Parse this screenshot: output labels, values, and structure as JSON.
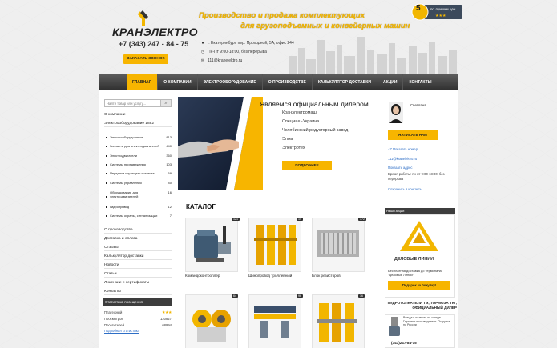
{
  "header": {
    "logo_text": "КРАНЭЛЕКТРО",
    "phone": "+7 (343) 247 - 84 - 75",
    "callback_label": "ЗАКАЗАТЬ ЗВОНОК",
    "tagline_1": "Производство и продажа комплектующих",
    "tagline_2": "для грузоподъемных и конвейерных машин",
    "address": "г. Екатеринбург, пер. Проходной, 5А, офис 244",
    "hours": "Пн-Пт 9:00-18:00, без перерыва",
    "email": "111@kranelektro.ru",
    "badge_number": "5",
    "badge_text": "по лучшим цен"
  },
  "nav": {
    "items": [
      {
        "label": "ГЛАВНАЯ"
      },
      {
        "label": "О КОМПАНИИ"
      },
      {
        "label": "ЭЛЕКТРООБОРУДОВАНИЕ"
      },
      {
        "label": "О ПРОИЗВОДСТВЕ"
      },
      {
        "label": "КАЛЬКУЛЯТОР ДОСТАВКИ"
      },
      {
        "label": "АКЦИИ"
      },
      {
        "label": "КОНТАКТЫ"
      }
    ]
  },
  "sidebar": {
    "search_placeholder": "Найти товар или услугу...",
    "search_icon": "search-icon",
    "link_company": "О компании",
    "link_equipment": "Электрооборудование 1882",
    "subitems": [
      {
        "label": "Электрооборудование",
        "count": "813"
      },
      {
        "label": "Запчасти для электродвигателей",
        "count": "440"
      },
      {
        "label": "Электродвигатели",
        "count": "360"
      },
      {
        "label": "Системы передвижения",
        "count": "103"
      },
      {
        "label": "Передача крутящего момента",
        "count": "69"
      },
      {
        "label": "Системы управления",
        "count": "40"
      },
      {
        "label": "Оборудование для электродвигателей",
        "count": "16"
      },
      {
        "label": "Гидропривод",
        "count": "12"
      },
      {
        "label": "Системы охраны, сигнализации",
        "count": "7"
      }
    ],
    "links": [
      {
        "label": "О производстве"
      },
      {
        "label": "Доставка и оплата"
      },
      {
        "label": "Отзывы"
      },
      {
        "label": "Калькулятор доставки"
      },
      {
        "label": "Новости"
      },
      {
        "label": "Статьи"
      },
      {
        "label": "Лицензии и сертификаты"
      },
      {
        "label": "Контакты"
      }
    ],
    "stats_title": "Статистика посещения",
    "stats": [
      {
        "label": "Платежный",
        "value": "★★★"
      },
      {
        "label": "Просмотров",
        "value": "120827"
      },
      {
        "label": "Посетителей",
        "value": "68994"
      }
    ],
    "stats_link": "Подробная статистика"
  },
  "banner": {
    "title": "Являемся официальным дилером",
    "items": [
      "Кранэлектромаш",
      "Спецмаш-Украина",
      "Челябинский редукторный завод",
      "Элма",
      "Электротех"
    ],
    "button": "ПОДРОБНЕЕ"
  },
  "catalog": {
    "title": "КАТАЛОГ",
    "items": [
      {
        "label": "Командоконтроллер",
        "count": "121"
      },
      {
        "label": "Шинопровод троллейный",
        "count": "14"
      },
      {
        "label": "Блок резисторов",
        "count": "372"
      },
      {
        "label": "",
        "count": "64"
      },
      {
        "label": "",
        "count": "96"
      },
      {
        "label": "",
        "count": "36"
      }
    ]
  },
  "manager": {
    "name": "Светлана",
    "write_button": "НАПИСАТЬ НАМ",
    "phone_link": "+7 Показать номер",
    "email": "111@kranelektro.ru",
    "show_address": "Показать адрес",
    "work_hours": "Время работы: пн-пт 9:00-18:00, без перерыва",
    "save_contact": "Сохранить в контакты"
  },
  "promo": {
    "title": "Наши акции",
    "brand": "ДЕЛОВЫЕ ЛИНИИ",
    "text": "Бесплатная доставка до терминала \"Деловые Линии\"",
    "button": "Подарок за покупку!"
  },
  "ad": {
    "title": "ГИДРОТОЛКАТЕЛИ ТЭ, ТОРМОЗА ТКГ, ОФИЦИАЛЬНЫЙ ДИЛЕР",
    "text": "Всегда в наличии на складе. Гарантия производителя. Отгрузка по России",
    "phone": "(343)247-84-75"
  },
  "colors": {
    "accent": "#f7b500",
    "nav_bg": "#3a3a3a",
    "link": "#2e6ec6"
  }
}
